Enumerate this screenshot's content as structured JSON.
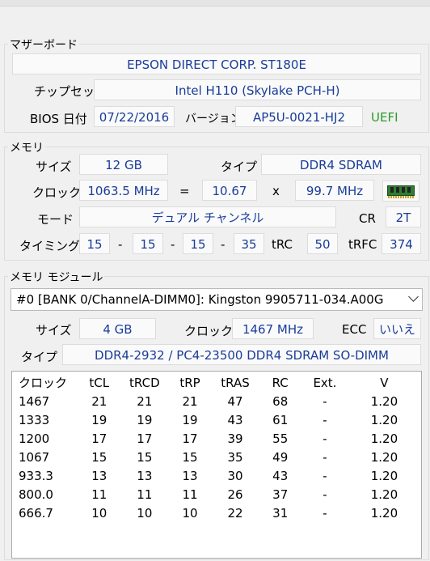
{
  "motherboard": {
    "title": "マザーボード",
    "name": "EPSON DIRECT CORP. ST180E",
    "chipset_label": "チップセット",
    "chipset": "Intel H110 (Skylake PCH-H)",
    "bios_label": "BIOS 日付",
    "bios_date": "07/22/2016",
    "version_label": "バージョン",
    "version": "AP5U-0021-HJ2",
    "uefi": "UEFI"
  },
  "memory": {
    "title": "メモリ",
    "size_label": "サイズ",
    "size": "12 GB",
    "type_label": "タイプ",
    "type": "DDR4 SDRAM",
    "clock_label": "クロック",
    "clock": "1063.5 MHz",
    "eq": "=",
    "mult": "10.67",
    "x": "x",
    "bclk": "99.7 MHz",
    "mode_label": "モード",
    "mode": "デュアル チャンネル",
    "cr_label": "CR",
    "cr": "2T",
    "timing_label": "タイミング",
    "t1": "15",
    "t2": "15",
    "t3": "15",
    "t4": "35",
    "dash": "-",
    "trc_label": "tRC",
    "trc": "50",
    "trfc_label": "tRFC",
    "trfc": "374"
  },
  "module": {
    "title": "メモリ モジュール",
    "selected": "#0 [BANK 0/ChannelA-DIMM0]: Kingston 9905711-034.A00G",
    "size_label": "サイズ",
    "size": "4 GB",
    "clock_label": "クロック",
    "clock": "1467 MHz",
    "ecc_label": "ECC",
    "ecc": "いいえ",
    "type_label": "タイプ",
    "type": "DDR4-2932 / PC4-23500 DDR4 SDRAM SO-DIMM"
  },
  "spd": {
    "headers": [
      "クロック",
      "tCL",
      "tRCD",
      "tRP",
      "tRAS",
      "RC",
      "Ext.",
      "V"
    ],
    "rows": [
      [
        "1467",
        "21",
        "21",
        "21",
        "47",
        "68",
        "-",
        "1.20"
      ],
      [
        "1333",
        "19",
        "19",
        "19",
        "43",
        "61",
        "-",
        "1.20"
      ],
      [
        "1200",
        "17",
        "17",
        "17",
        "39",
        "55",
        "-",
        "1.20"
      ],
      [
        "1067",
        "15",
        "15",
        "15",
        "35",
        "49",
        "-",
        "1.20"
      ],
      [
        "933.3",
        "13",
        "13",
        "13",
        "30",
        "43",
        "-",
        "1.20"
      ],
      [
        "800.0",
        "11",
        "11",
        "11",
        "26",
        "37",
        "-",
        "1.20"
      ],
      [
        "666.7",
        "10",
        "10",
        "10",
        "22",
        "31",
        "-",
        "1.20"
      ]
    ]
  }
}
